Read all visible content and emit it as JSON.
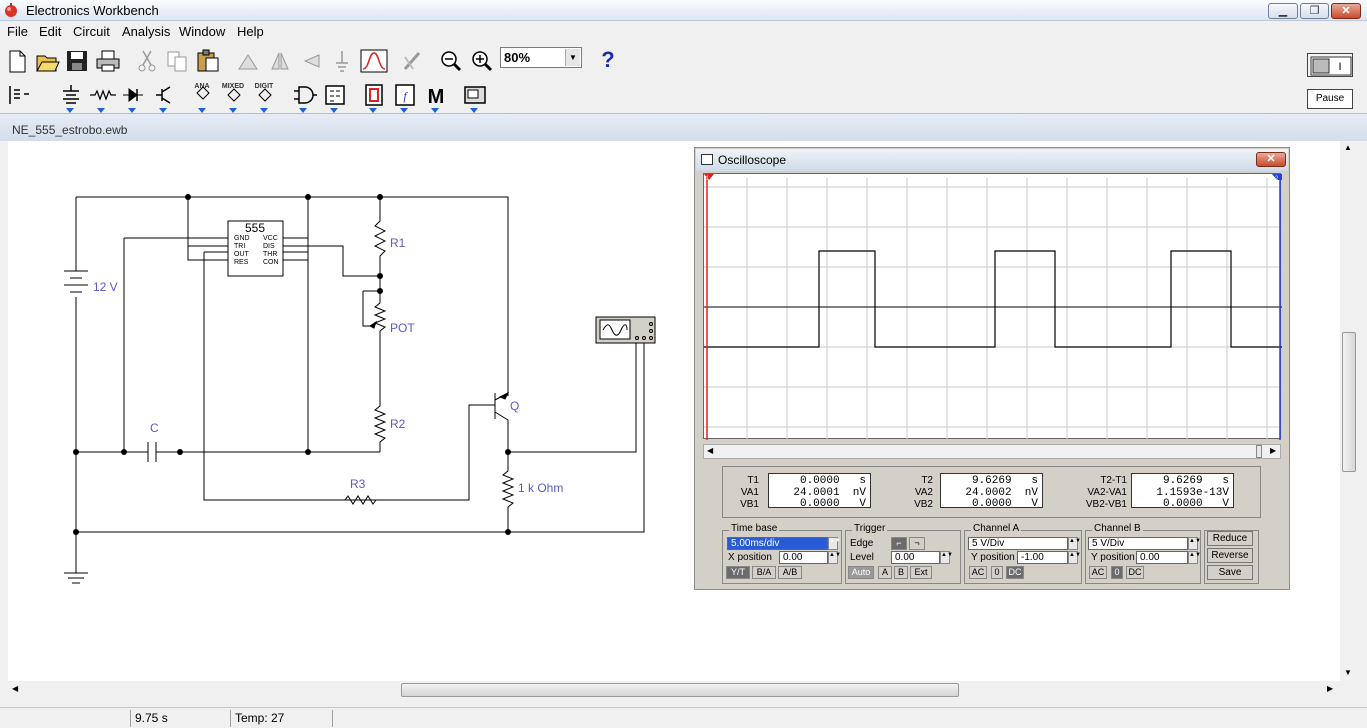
{
  "app": {
    "title": "Electronics Workbench"
  },
  "window_controls": {
    "minimize": "▁",
    "maximize": "❐",
    "close": "✕"
  },
  "menu": [
    "File",
    "Edit",
    "Circuit",
    "Analysis",
    "Window",
    "Help"
  ],
  "toolbar1": {
    "buttons": [
      "new-icon",
      "open-icon",
      "save-icon",
      "print-icon",
      "cut-icon",
      "copy-icon",
      "paste-icon",
      "rotate-icon",
      "flip-horizontal-icon",
      "flip-vertical-icon",
      "component-properties-icon",
      "create-subcircuit-icon",
      "graph-icon",
      "zoom-out-icon",
      "zoom-in-icon"
    ],
    "zoom": "80%",
    "help": "?"
  },
  "toolbar2": {
    "bins": [
      "favorites-bin",
      "sources-bin",
      "basic-bin",
      "diodes-bin",
      "transistors-bin",
      "analog-ics-bin",
      "mixed-ics-bin",
      "digital-ics-bin",
      "logic-gates-bin",
      "digital-bin",
      "indicators-bin",
      "controls-bin",
      "miscellaneous-bin",
      "instruments-bin"
    ],
    "ana": "ANA",
    "mixed": "MIXED",
    "digit": "DIGIT",
    "m": "M"
  },
  "power_switch": {
    "label": "I"
  },
  "pause_button": "Pause",
  "document": {
    "title": "NE_555_estrobo.ewb"
  },
  "circuit": {
    "battery": "12 V",
    "ic": {
      "name": "555",
      "left_pins": [
        "GND",
        "TRI",
        "OUT",
        "RES"
      ],
      "right_pins": [
        "VCC",
        "DIS",
        "THR",
        "CON"
      ]
    },
    "r1": "R1",
    "pot": "POT",
    "r2": "R2",
    "cap": "C",
    "r3": "R3",
    "q": "Q",
    "load": "1 k Ohm"
  },
  "oscilloscope": {
    "title": "Oscilloscope",
    "cursor1": "1",
    "cursor2": "2",
    "readout": {
      "t1": {
        "label": "T1",
        "va": "VA1",
        "vb": "VB1",
        "t_val": "0.0000   s",
        "va_val": "24.0001  nV",
        "vb_val": "0.0000   V"
      },
      "t2": {
        "label": "T2",
        "va": "VA2",
        "vb": "VB2",
        "t_val": "9.6269   s",
        "va_val": "24.0002  nV",
        "vb_val": "0.0000   V"
      },
      "diff": {
        "label": "T2-T1",
        "va": "VA2-VA1",
        "vb": "VB2-VB1",
        "t_val": "9.6269   s",
        "va_val": "1.1593e-13V",
        "vb_val": "0.0000   V"
      }
    },
    "timebase": {
      "title": "Time base",
      "value": "5.00ms/div",
      "xpos_label": "X position",
      "xpos": "0.00",
      "yt": "Y/T",
      "ba": "B/A",
      "ab": "A/B"
    },
    "trigger": {
      "title": "Trigger",
      "edge_label": "Edge",
      "level_label": "Level",
      "level": "0.00",
      "auto": "Auto",
      "a": "A",
      "b": "B",
      "ext": "Ext"
    },
    "channel_a": {
      "title": "Channel A",
      "scale": "5 V/Div",
      "ypos_label": "Y position",
      "ypos": "-1.00",
      "ac": "AC",
      "zero": "0",
      "dc": "DC"
    },
    "channel_b": {
      "title": "Channel B",
      "scale": "5 V/Div",
      "ypos_label": "Y position",
      "ypos": "0.00",
      "ac": "AC",
      "zero": "0",
      "dc": "DC"
    },
    "buttons": {
      "reduce": "Reduce",
      "reverse": "Reverse",
      "save": "Save"
    },
    "trace": {
      "high_y_div": 1.0,
      "low_y_div": -1.0,
      "rises_at_div": [
        2.8,
        7.2,
        11.6
      ],
      "falls_at_div": [
        4.2,
        8.7,
        13.1
      ]
    }
  },
  "status": {
    "time": "9.75 s",
    "temp": "Temp:  27"
  }
}
